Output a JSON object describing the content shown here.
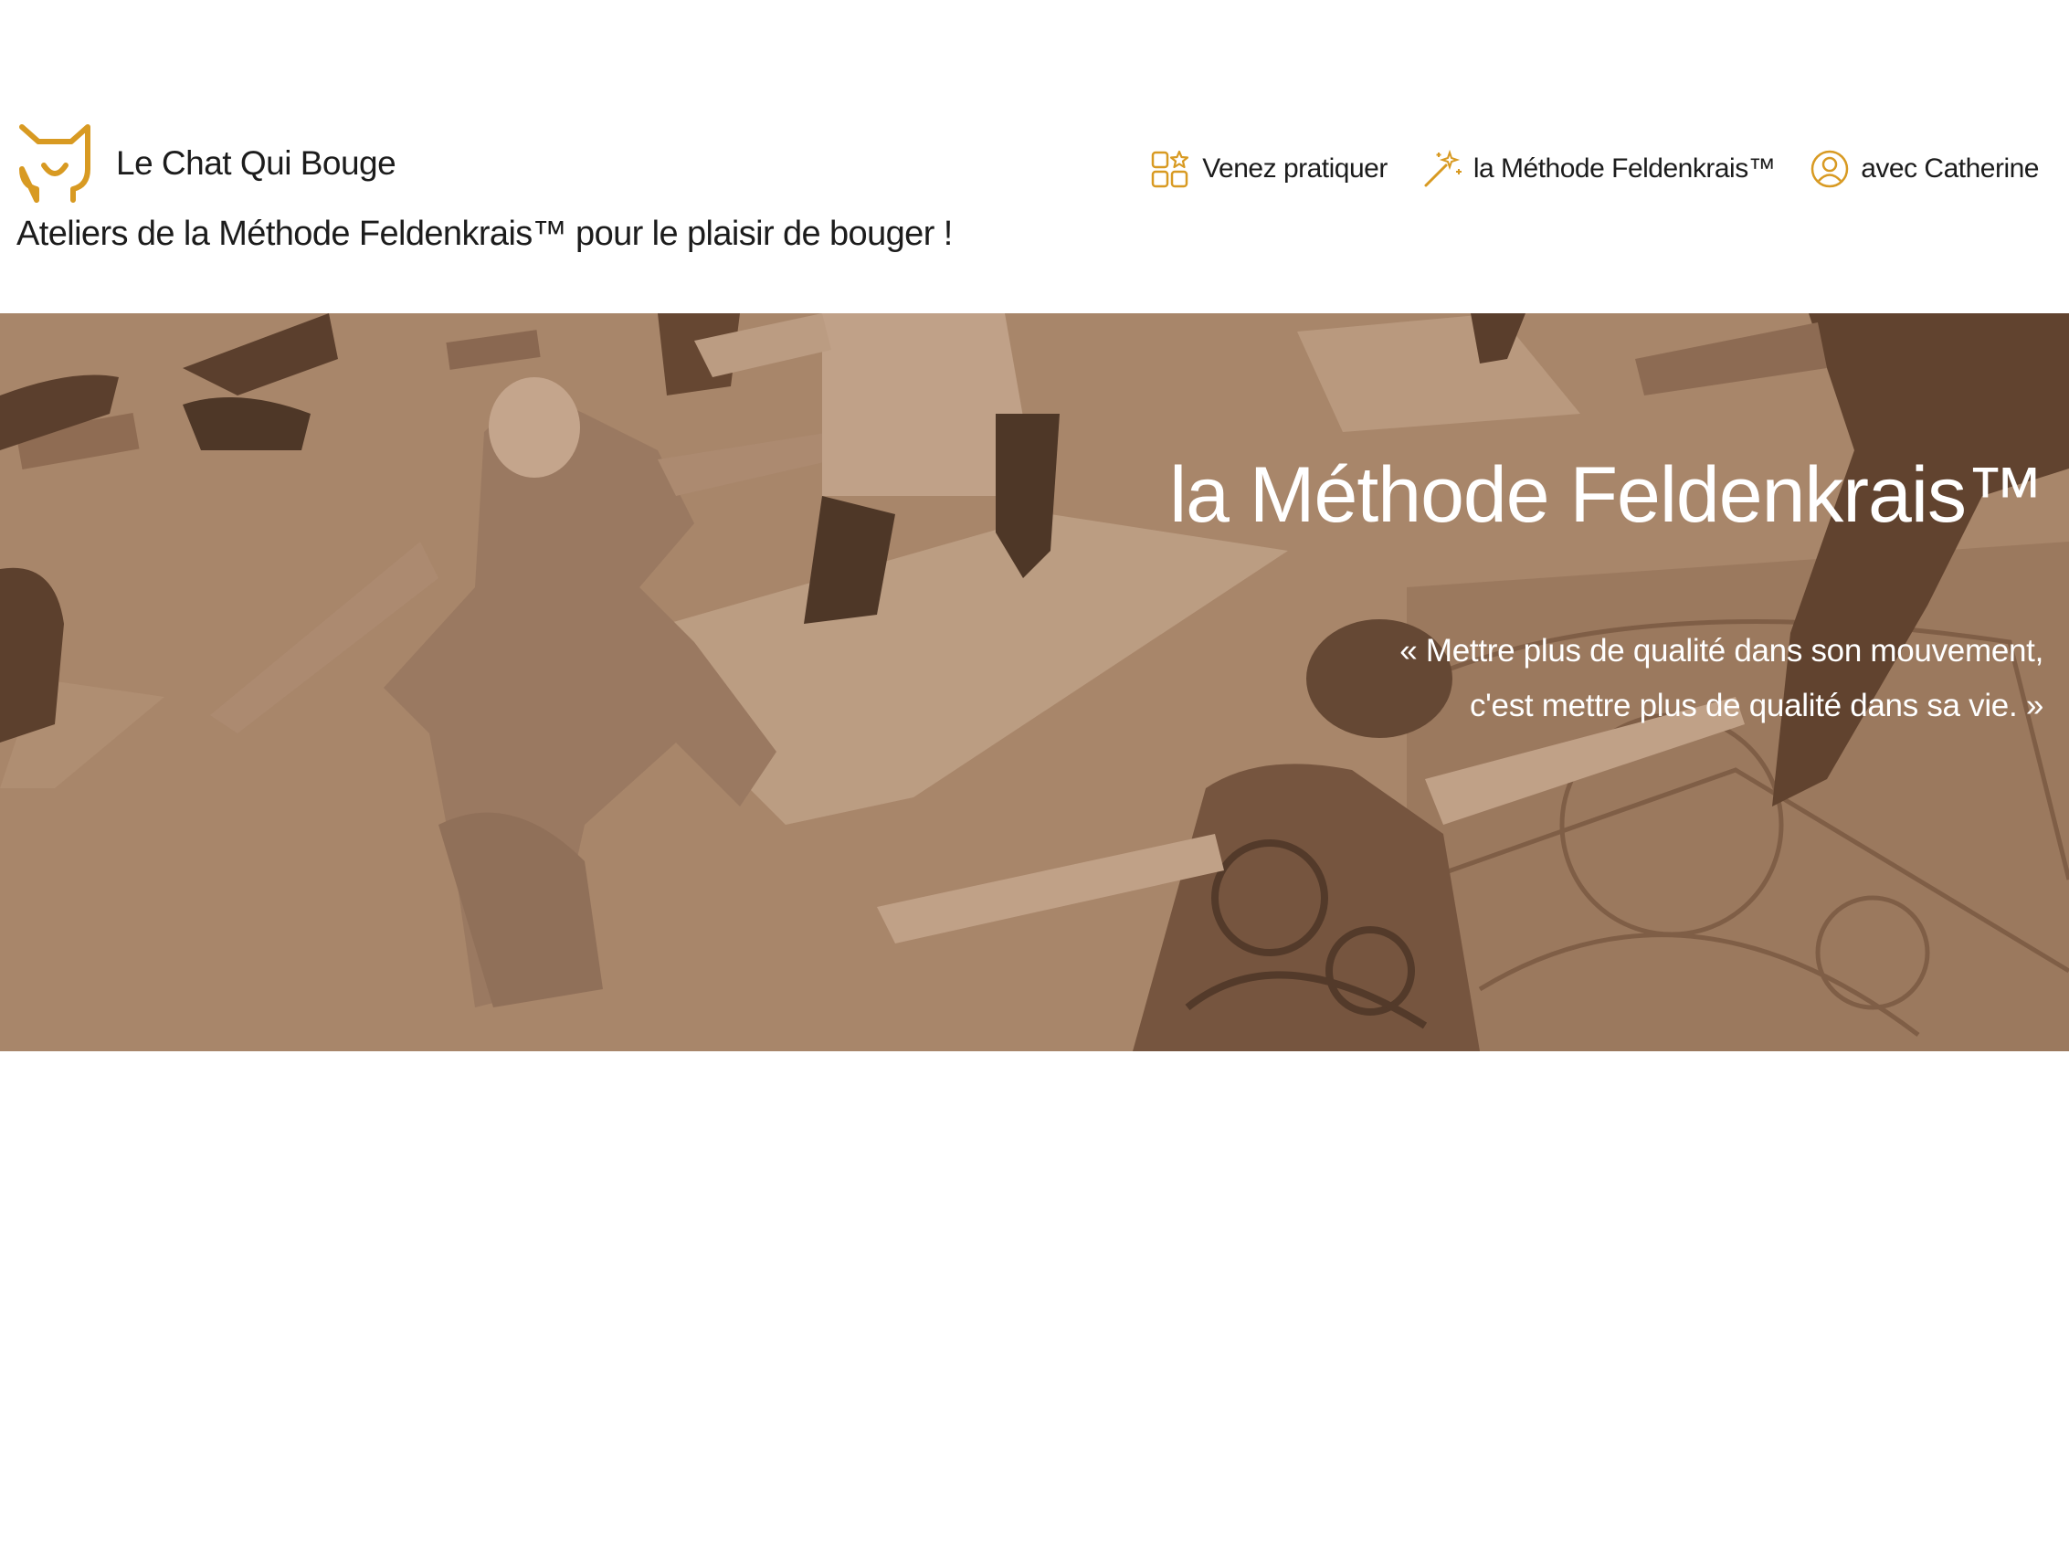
{
  "header": {
    "site_title": "Le Chat Qui Bouge",
    "tagline": "Ateliers de la Méthode Feldenkrais™ pour le plaisir de bouger !",
    "logo_icon": "cat-head-icon",
    "accent_color": "#d89a22"
  },
  "nav": {
    "items": [
      {
        "label": "Venez pratiquer",
        "icon": "grid-star-icon"
      },
      {
        "label": "la Méthode Feldenkrais™",
        "icon": "magic-wand-icon"
      },
      {
        "label": "avec Catherine",
        "icon": "user-circle-icon"
      }
    ]
  },
  "hero": {
    "title": "la Méthode Feldenkrais™",
    "quote_line1": "« Mettre plus de qualité dans son mouvement,",
    "quote_line2": "c'est mettre plus de qualité dans sa vie. »",
    "image_tint": "#a8856a"
  }
}
